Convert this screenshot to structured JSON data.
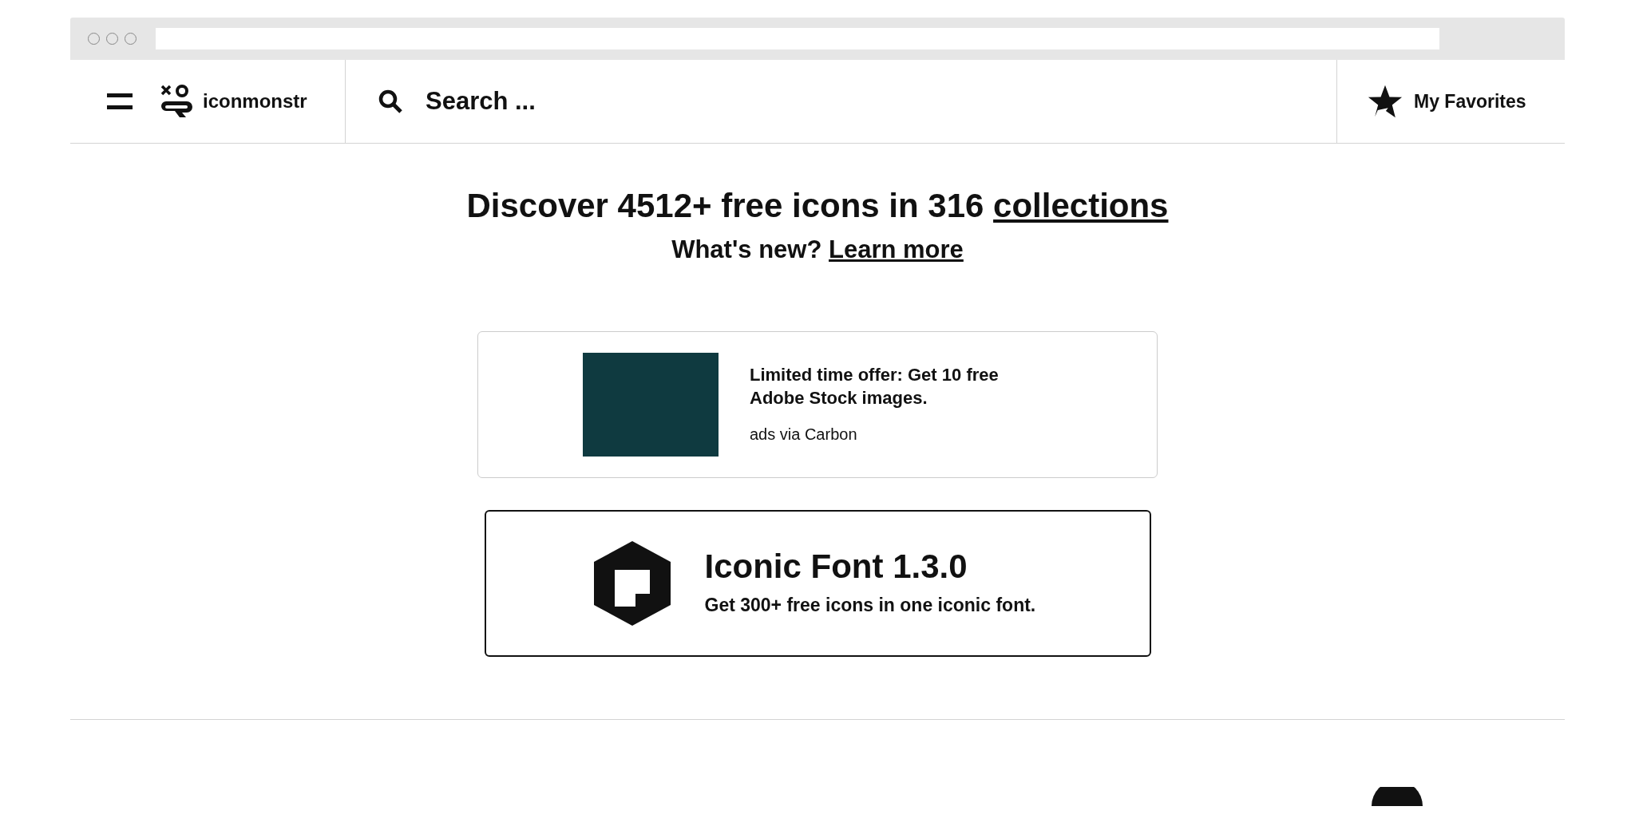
{
  "header": {
    "brand": "iconmonstr",
    "search": {
      "placeholder": "Search ..."
    },
    "favorites": "My Favorites"
  },
  "hero": {
    "headline": {
      "text": "Discover 4512+ free icons in 316",
      "link": "collections"
    },
    "subline": {
      "text": "What's new?",
      "link": "Learn more"
    }
  },
  "ad": {
    "title": "Limited time offer: Get 10 free Adobe Stock images.",
    "source": "ads via Carbon"
  },
  "promo": {
    "title": "Iconic Font 1.3.0",
    "subtitle": "Get 300+ free icons in one iconic font."
  }
}
